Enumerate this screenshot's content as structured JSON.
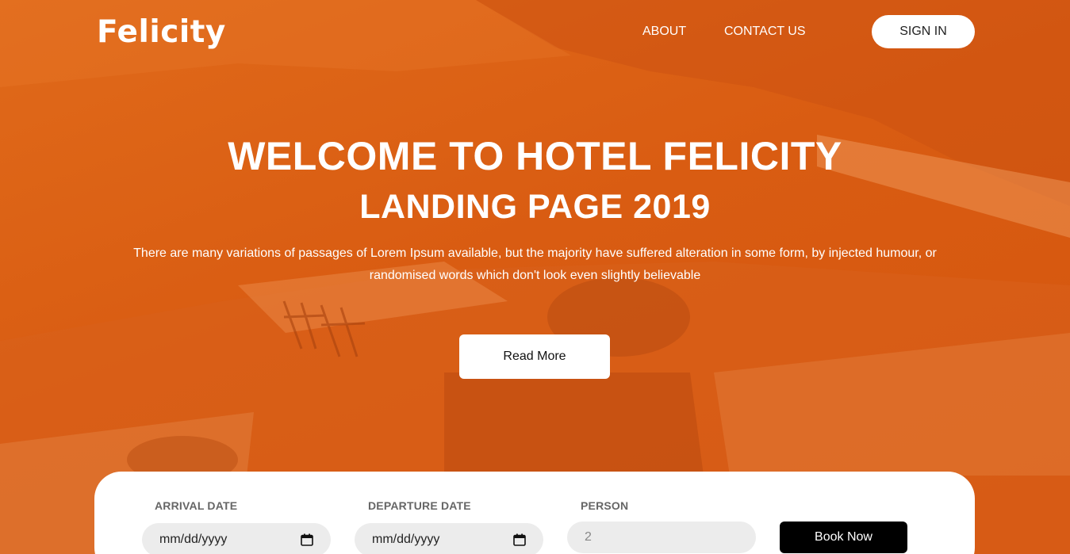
{
  "brand": {
    "logo": "Felicity"
  },
  "nav": {
    "about": "ABOUT",
    "contact": "CONTACT US",
    "signin": "SIGN IN"
  },
  "hero": {
    "title": "WELCOME TO HOTEL FELICITY",
    "subtitle": "LANDING PAGE 2019",
    "description": "There are many variations of passages of Lorem Ipsum available, but the majority have suffered alteration in some form, by injected humour, or randomised words which don't look even slightly believable",
    "cta": "Read More"
  },
  "booking": {
    "arrival_label": "ARRIVAL DATE",
    "arrival_value": "mm/dd/yyyy",
    "departure_label": "DEPARTURE DATE",
    "departure_value": "mm/dd/yyyy",
    "person_label": "PERSON",
    "person_placeholder": "2",
    "submit": "Book Now"
  },
  "colors": {
    "overlay": "#d95c12",
    "button_dark": "#000000",
    "field_bg": "#ececec"
  },
  "icons": {
    "date_picker": "calendar-icon"
  }
}
